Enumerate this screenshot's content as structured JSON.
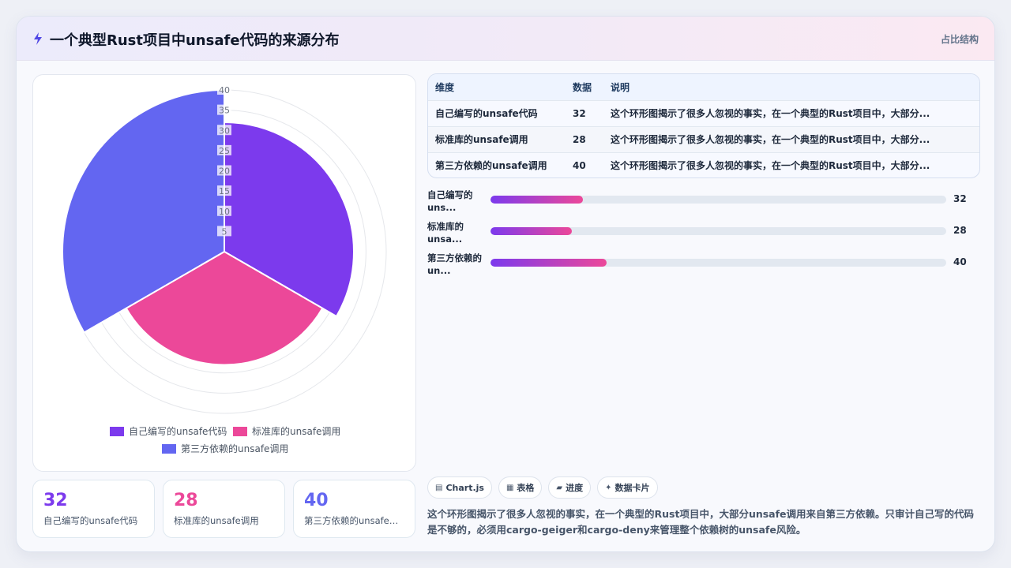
{
  "header": {
    "title": "一个典型Rust项目中unsafe代码的来源分布",
    "tag": "占比结构"
  },
  "colors": {
    "series": [
      "#7c3aed",
      "#ec4899",
      "#6366f1"
    ]
  },
  "chart_data": {
    "type": "polarArea",
    "categories": [
      "自己编写的unsafe代码",
      "标准库的unsafe调用",
      "第三方依赖的unsafe调用"
    ],
    "values": [
      32,
      28,
      40
    ],
    "rlim": [
      0,
      40
    ],
    "ticks": [
      "40",
      "35",
      "30",
      "25",
      "20",
      "15",
      "10",
      "5"
    ],
    "legend": "bottom"
  },
  "stats": [
    {
      "value": "32",
      "label": "自己编写的unsafe代码",
      "color": "#7c3aed"
    },
    {
      "value": "28",
      "label": "标准库的unsafe调用",
      "color": "#ec4899"
    },
    {
      "value": "40",
      "label": "第三方依赖的unsafe调用",
      "color": "#6366f1"
    }
  ],
  "table": {
    "headers": [
      "维度",
      "数据",
      "说明"
    ],
    "rows": [
      [
        "自己编写的unsafe代码",
        "32",
        "这个环形图揭示了很多人忽视的事实，在一个典型的Rust项目中，大部分..."
      ],
      [
        "标准库的unsafe调用",
        "28",
        "这个环形图揭示了很多人忽视的事实，在一个典型的Rust项目中，大部分..."
      ],
      [
        "第三方依赖的unsafe调用",
        "40",
        "这个环形图揭示了很多人忽视的事实，在一个典型的Rust项目中，大部分..."
      ]
    ]
  },
  "progress": [
    {
      "label": "自己编写的uns...",
      "value": "32",
      "fraction": 0.203
    },
    {
      "label": "标准库的unsa...",
      "value": "28",
      "fraction": 0.178
    },
    {
      "label": "第三方依赖的un...",
      "value": "40",
      "fraction": 0.254
    }
  ],
  "chips": [
    {
      "icon": "▤",
      "label": "Chart.js"
    },
    {
      "icon": "▦",
      "label": "表格"
    },
    {
      "icon": "▰",
      "label": "进度"
    },
    {
      "icon": "✦",
      "label": "数据卡片"
    }
  ],
  "note": "这个环形图揭示了很多人忽视的事实，在一个典型的Rust项目中，大部分unsafe调用来自第三方依赖。只审计自己写的代码是不够的，必须用cargo-geiger和cargo-deny来管理整个依赖树的unsafe风险。"
}
